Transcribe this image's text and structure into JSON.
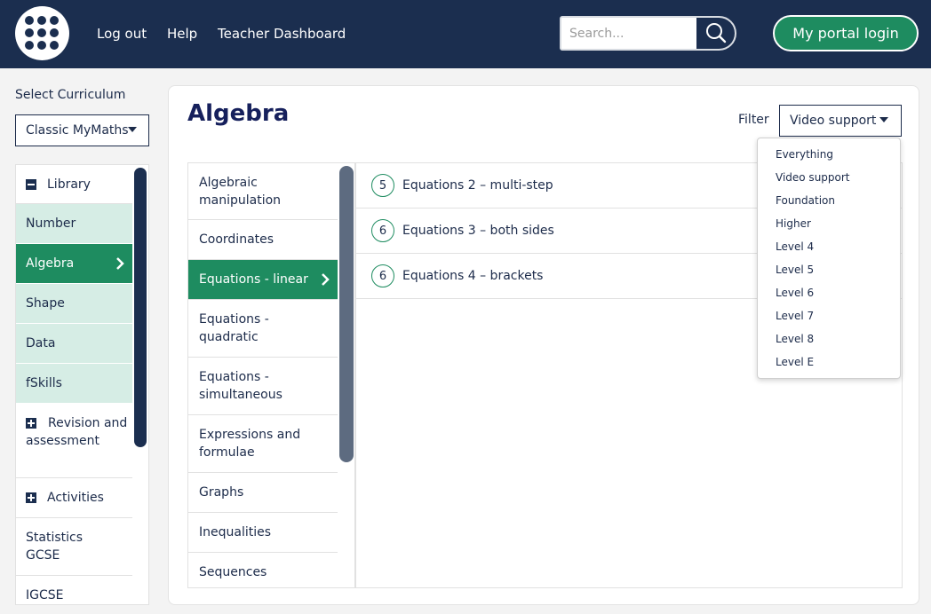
{
  "header": {
    "nav": [
      "Log out",
      "Help",
      "Teacher Dashboard"
    ],
    "search_placeholder": "Search...",
    "portal_button": "My portal login"
  },
  "curriculum": {
    "label": "Select Curriculum",
    "selected": "Classic MyMaths"
  },
  "sidebar": {
    "items": [
      {
        "label": "Library",
        "icon": "minus-icon"
      },
      {
        "label": "Number"
      },
      {
        "label": "Algebra",
        "active": true
      },
      {
        "label": "Shape"
      },
      {
        "label": "Data"
      },
      {
        "label": "fSkills"
      },
      {
        "label": "Revision and assessment",
        "icon": "plus-icon"
      },
      {
        "label": "Activities",
        "icon": "plus-icon"
      },
      {
        "label": "Statistics GCSE"
      },
      {
        "label": "IGCSE"
      }
    ]
  },
  "main": {
    "title": "Algebra",
    "filter_label": "Filter",
    "filter_selected": "Video support"
  },
  "topics": [
    "Algebraic manipulation",
    "Coordinates",
    "Equations - linear",
    "Equations - quadratic",
    "Equations - simultaneous",
    "Expressions and formulae",
    "Graphs",
    "Inequalities",
    "Sequences"
  ],
  "lessons": [
    {
      "level": "5",
      "title": "Equations 2 – multi-step"
    },
    {
      "level": "6",
      "title": "Equations 3 – both sides"
    },
    {
      "level": "6",
      "title": "Equations 4 – brackets"
    }
  ],
  "filter_options": [
    "Everything",
    "Video support",
    "Foundation",
    "Higher",
    "Level 4",
    "Level 5",
    "Level 6",
    "Level 7",
    "Level 8",
    "Level E"
  ],
  "colors": {
    "header_bg": "#1b2e4f",
    "accent_green": "#1e8c60",
    "light_green": "#d6ede5",
    "title_navy": "#16205c"
  }
}
